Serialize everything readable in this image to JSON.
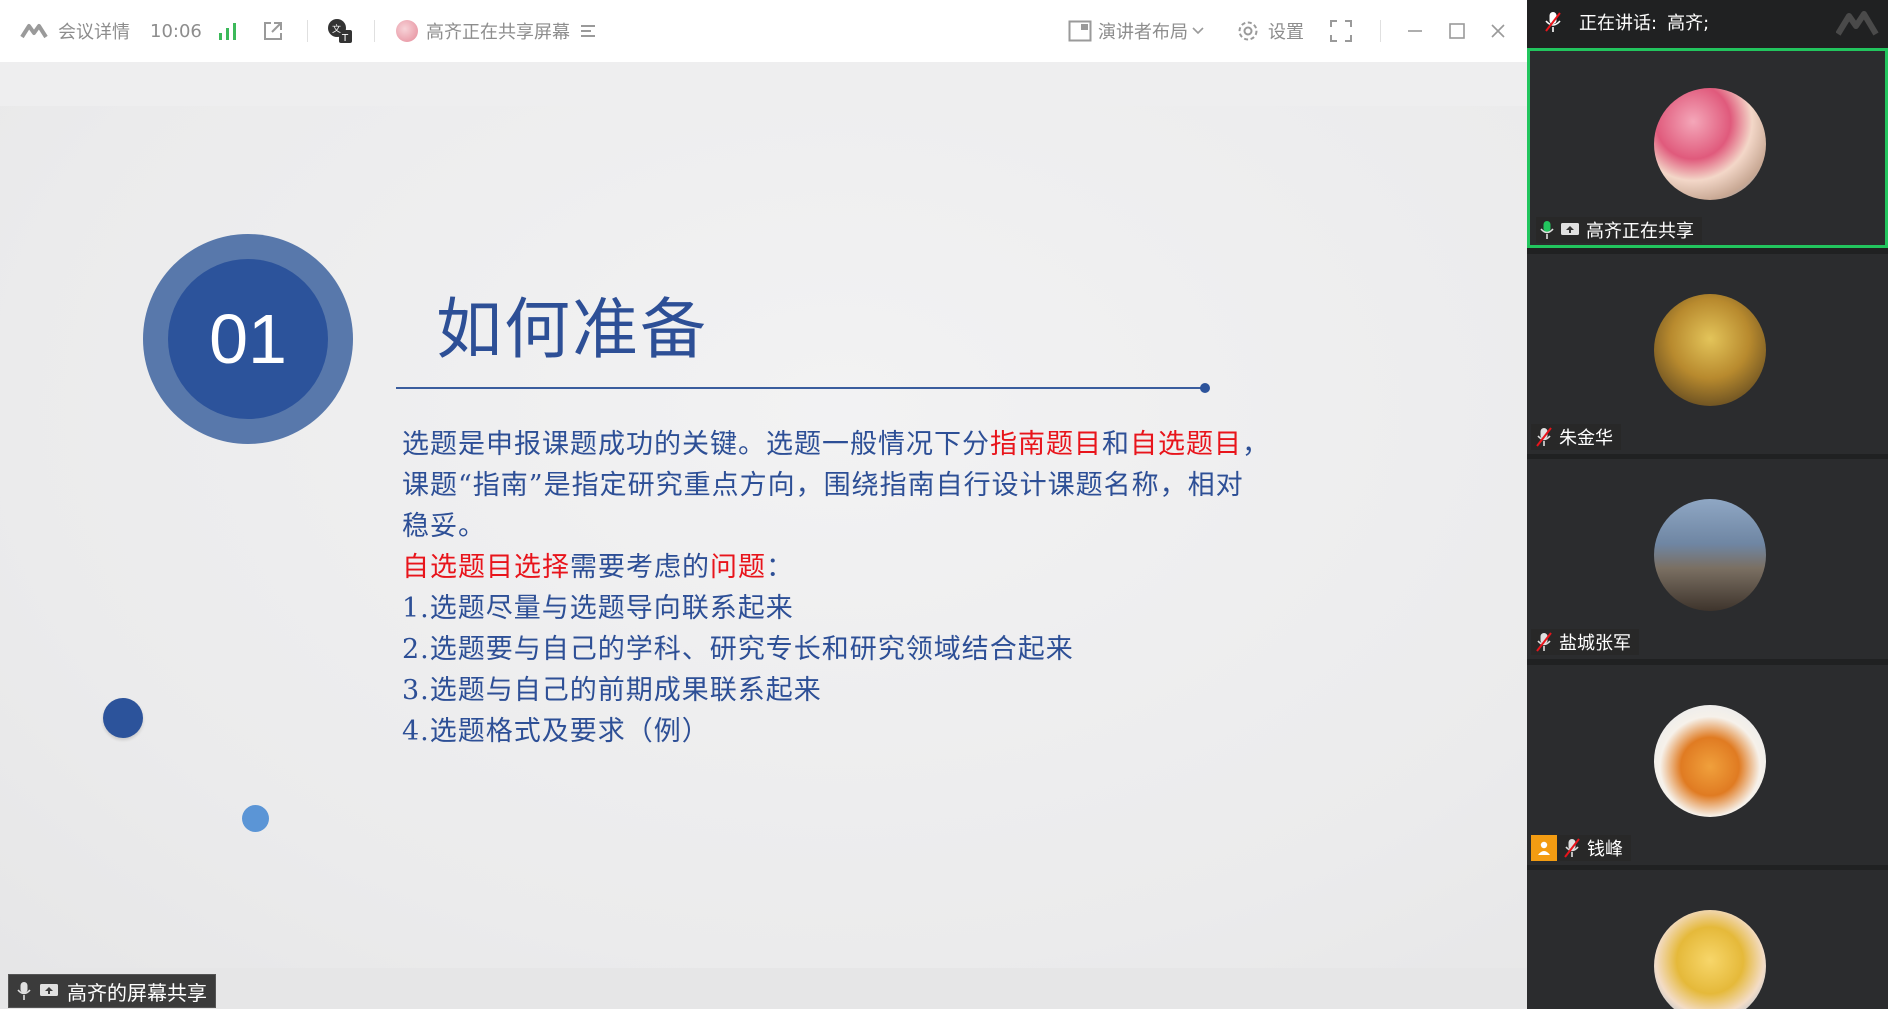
{
  "toolbar": {
    "meeting_details": "会议详情",
    "time": "10:06",
    "sharing_status": "高齐正在共享屏幕",
    "layout_label": "演讲者布局",
    "settings_label": "设置"
  },
  "slide": {
    "number": "01",
    "title": "如何准备",
    "lines": [
      {
        "a": "选题是申报课题成功的关键。选题一般情况下分",
        "r1": "指南题目",
        "b": "和",
        "r2": "自选题目",
        "c": "，"
      },
      {
        "text": "课题“指南”是指定研究重点方向，围绕指南自行设计课题名称，相对"
      },
      {
        "text": "稳妥。"
      },
      {
        "r1": "自选题目选择",
        "b": "需要考虑的",
        "r2": "问题",
        "c": "："
      },
      {
        "text": "1.选题尽量与选题导向联系起来"
      },
      {
        "text": "2.选题要与自己的学科、研究专长和研究领域结合起来"
      },
      {
        "text": "3.选题与自己的前期成果联系起来"
      },
      {
        "text": "4.选题格式及要求（例）"
      }
    ]
  },
  "screen_share_label": "高齐的屏幕共享",
  "panel": {
    "speaking_prefix": "正在讲话:",
    "speaking_name": "高齐;",
    "participants": [
      {
        "name": "高齐正在共享"
      },
      {
        "name": "朱金华"
      },
      {
        "name": "盐城张军"
      },
      {
        "name": "钱峰"
      },
      {
        "name": ""
      }
    ]
  },
  "colors": {
    "title_blue": "#2d4f96",
    "highlight_red": "#e8141b",
    "active_border": "#22c55e"
  }
}
